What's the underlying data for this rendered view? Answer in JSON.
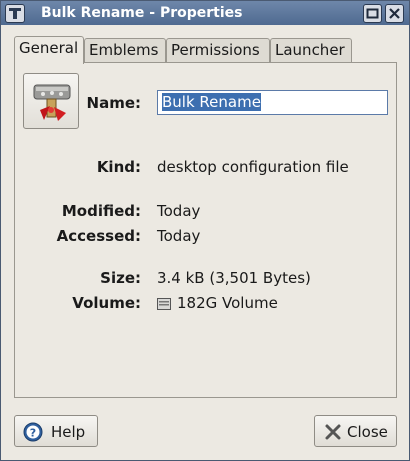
{
  "window": {
    "title": "Bulk Rename - Properties"
  },
  "tabs": [
    {
      "label": "General",
      "active": true
    },
    {
      "label": "Emblems",
      "active": false
    },
    {
      "label": "Permissions",
      "active": false
    },
    {
      "label": "Launcher",
      "active": false
    }
  ],
  "general": {
    "name_label": "Name:",
    "name_value": "Bulk Rename",
    "kind_label": "Kind:",
    "kind_value": "desktop configuration file",
    "modified_label": "Modified:",
    "modified_value": "Today",
    "accessed_label": "Accessed:",
    "accessed_value": "Today",
    "size_label": "Size:",
    "size_value": "3.4 kB (3,501 Bytes)",
    "volume_label": "Volume:",
    "volume_value": "182G Volume"
  },
  "buttons": {
    "help": "Help",
    "close": "Close"
  },
  "icons": {
    "app_icon": "bulk-rename-stamp-icon",
    "help_icon": "help-icon",
    "close_icon": "close-icon",
    "volume_icon": "hard-disk-icon"
  },
  "colors": {
    "titlebar": "#5b7399",
    "selection": "#3d6fb0"
  }
}
